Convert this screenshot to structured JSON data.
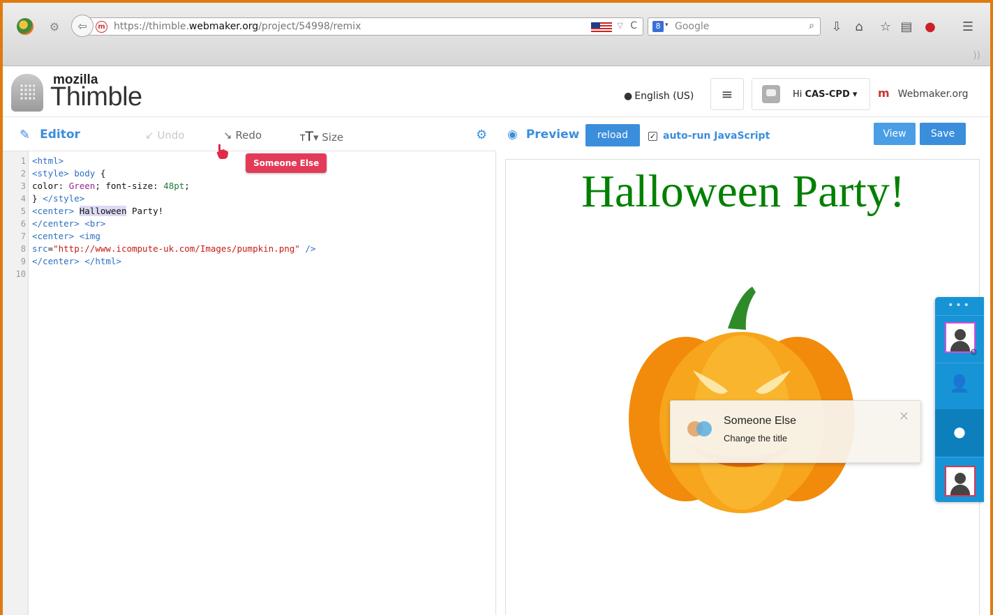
{
  "browser": {
    "url_prefix": "https://thimble.",
    "url_host": "webmaker.org",
    "url_path": "/project/54998/remix",
    "search_placeholder": "Google",
    "site_icon_letter": "m",
    "search_engine_letter": "8",
    "icons": [
      "firefox-icon",
      "addon-icon",
      "back-arrow-icon",
      "site-icon",
      "us-flag-icon",
      "reload-icon",
      "search-icon",
      "download-icon",
      "home-icon",
      "bookmark-star-icon",
      "reading-list-icon",
      "pinterest-icon",
      "hamburger-menu-icon",
      "rss-icon"
    ]
  },
  "header": {
    "brand_top": "mozilla",
    "brand_main": "Thimble",
    "language": "English (US)",
    "greeting": "Hi ",
    "username": "CAS-CPD",
    "webmaker_letter": "m",
    "webmaker_label": "Webmaker.org"
  },
  "editor_toolbar": {
    "tab_label": "Editor",
    "undo_label": "Undo",
    "redo_label": "Redo",
    "size_label": "Size"
  },
  "code": {
    "line_numbers": [
      "1",
      "2",
      "3",
      "4",
      "5",
      "6",
      "7",
      "8",
      "9",
      "10"
    ]
  },
  "collaborator": {
    "cursor_name": "Someone Else",
    "notification_name": "Someone Else",
    "notification_message": "Change the title"
  },
  "preview_toolbar": {
    "tab_label": "Preview",
    "reload_label": "reload",
    "autorun_label": "auto-run JavaScript",
    "autorun_checked": true,
    "view_label": "View",
    "save_label": "Save"
  },
  "preview": {
    "heading": "Halloween Party!",
    "heading_color": "#008000"
  },
  "colors": {
    "accent": "#3b8edb",
    "frame": "#e07a10",
    "collab_tag": "#e23b57",
    "side_panel": "#1794d6"
  }
}
